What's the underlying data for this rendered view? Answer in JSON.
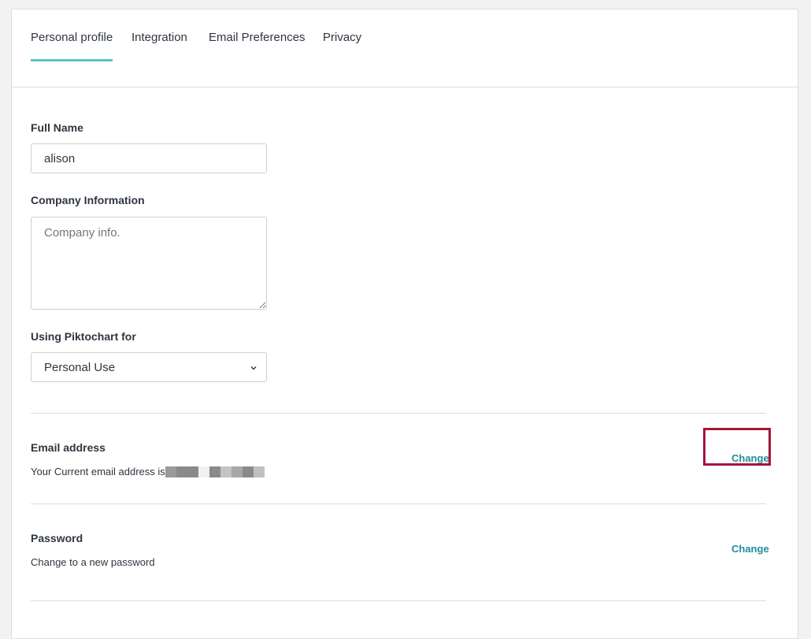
{
  "tabs": [
    {
      "label": "Personal profile",
      "active": true
    },
    {
      "label": "Integration",
      "active": false
    },
    {
      "label": "Email Preferences",
      "active": false
    },
    {
      "label": "Privacy",
      "active": false
    }
  ],
  "form": {
    "full_name": {
      "label": "Full Name",
      "value": "alison"
    },
    "company": {
      "label": "Company Information",
      "placeholder": "Company info."
    },
    "usage": {
      "label": "Using Piktochart for",
      "selected": "Personal Use"
    }
  },
  "email_section": {
    "title": "Email address",
    "description": "Your Current email address is",
    "change_label": "Change"
  },
  "password_section": {
    "title": "Password",
    "description": "Change to a new password",
    "change_label": "Change"
  },
  "colors": {
    "tab_underline": "#59c3c8",
    "link": "#1e8f9a",
    "highlight": "#a3163a"
  }
}
